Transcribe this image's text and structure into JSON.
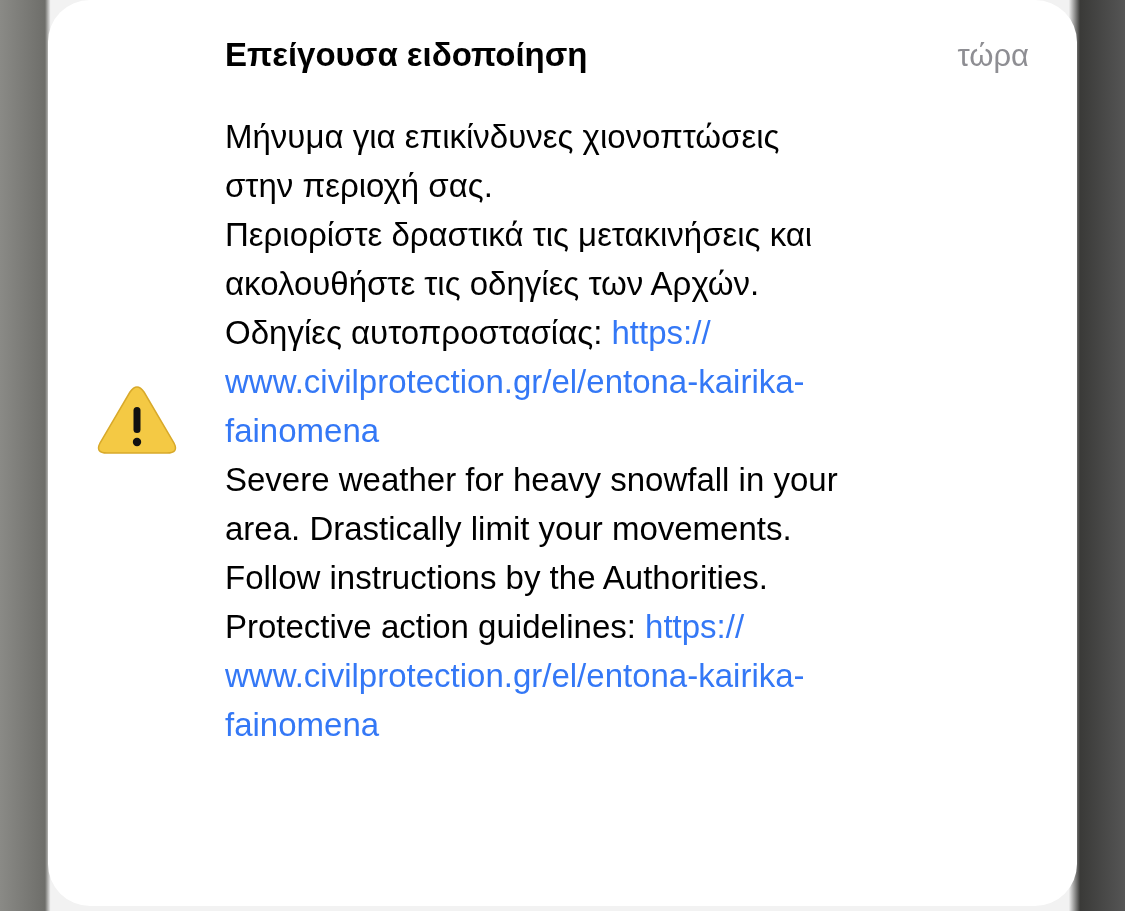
{
  "notification": {
    "title": "Επείγουσα ειδοποίηση",
    "time": "τώρα",
    "paragraphs": [
      {
        "lines": [
          "Μήνυμα για επικίνδυνες χιονοπτώσεις",
          "στην περιοχή σας."
        ]
      },
      {
        "lines": [
          "Περιορίστε δραστικά τις μετακινήσεις και",
          "ακολουθήστε τις οδηγίες των Αρχών."
        ]
      },
      {
        "lines": [
          "Οδηγίες αυτοπροστασίας:"
        ],
        "link_lines": [
          "https://",
          "www.civilprotection.gr/el/entona-kairika-",
          "fainomena"
        ]
      },
      {
        "lines": [
          "Severe weather for heavy snowfall in your",
          "area. Drastically limit your movements.",
          "Follow instructions by the Authorities."
        ]
      },
      {
        "lines": [
          "Protective action guidelines:"
        ],
        "link_lines": [
          "https://",
          "www.civilprotection.gr/el/entona-kairika-",
          "fainomena"
        ]
      }
    ]
  }
}
